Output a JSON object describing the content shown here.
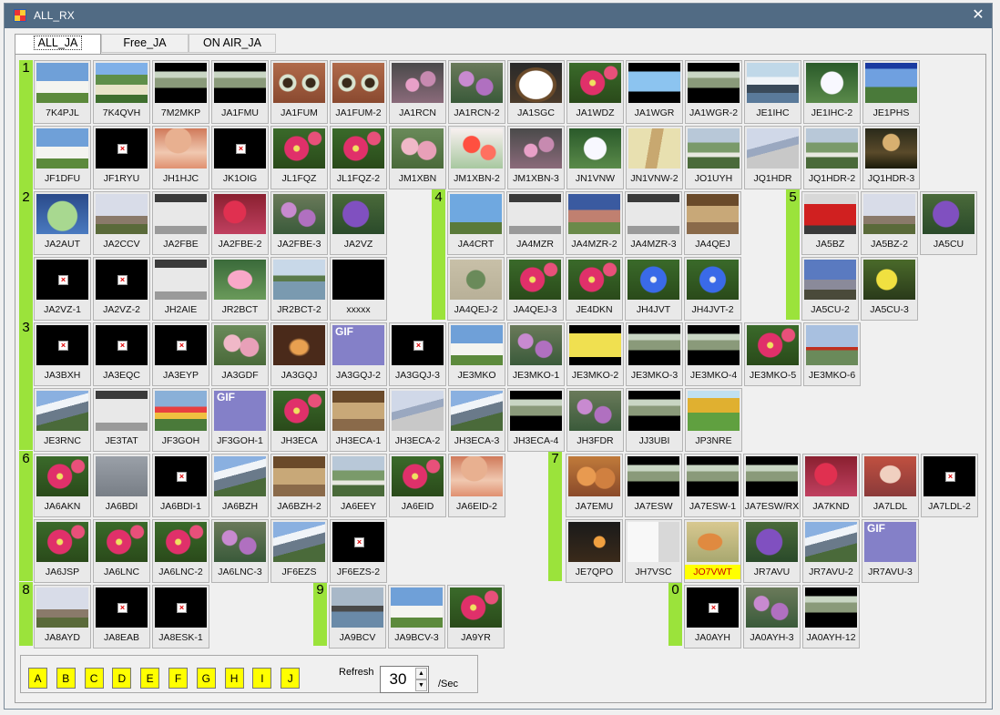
{
  "window": {
    "title": "ALL_RX",
    "close_glyph": "✕"
  },
  "tabs": [
    {
      "label": "ALL_JA",
      "active": true
    },
    {
      "label": "Free_JA",
      "active": false
    },
    {
      "label": "ON AIR_JA",
      "active": false
    }
  ],
  "area_markers": [
    "1",
    "2",
    "3",
    "4",
    "5",
    "6",
    "7",
    "8",
    "9",
    "0"
  ],
  "tiles": [
    {
      "c": "7K4PJL",
      "t": "bldg"
    },
    {
      "c": "7K4QVH",
      "t": "sign"
    },
    {
      "c": "7M2MKP",
      "t": "vid"
    },
    {
      "c": "JA1FMU",
      "t": "vid"
    },
    {
      "c": "JA1FUM",
      "t": "eyes"
    },
    {
      "c": "JA1FUM-2",
      "t": "eyes"
    },
    {
      "c": "JA1RCN",
      "t": "flw"
    },
    {
      "c": "JA1RCN-2",
      "t": "pflw"
    },
    {
      "c": "JA1SGC",
      "t": "bowl"
    },
    {
      "c": "JA1WDZ",
      "t": "pink"
    },
    {
      "c": "JA1WGR",
      "t": "sky"
    },
    {
      "c": "JA1WGR-2",
      "t": "vid"
    },
    {
      "c": "JE1IHC",
      "t": "wave"
    },
    {
      "c": "JE1IHC-2",
      "t": "lily"
    },
    {
      "c": "JE1PHS",
      "t": "blue"
    },
    {
      "c": "JF1DFU",
      "t": "bldg"
    },
    {
      "c": "JF1RYU",
      "t": "x"
    },
    {
      "c": "JH1HJC",
      "t": "hat"
    },
    {
      "c": "JK1OIG",
      "t": "x"
    },
    {
      "c": "JL1FQZ",
      "t": "pink"
    },
    {
      "c": "JL1FQZ-2",
      "t": "pink"
    },
    {
      "c": "JM1XBN",
      "t": "rose"
    },
    {
      "c": "JM1XBN-2",
      "t": "poppy"
    },
    {
      "c": "JM1XBN-3",
      "t": "flw"
    },
    {
      "c": "JN1VNW",
      "t": "lily"
    },
    {
      "c": "JN1VNW-2",
      "t": "hand"
    },
    {
      "c": "JO1UYH",
      "t": "garden"
    },
    {
      "c": "JQ1HDR",
      "t": "mtn"
    },
    {
      "c": "JQ1HDR-2",
      "t": "garden"
    },
    {
      "c": "JQ1HDR-3",
      "t": "lisa"
    },
    {
      "c": "JA2AUT",
      "t": "hydr"
    },
    {
      "c": "JA2CCV",
      "t": "tree"
    },
    {
      "c": "JA2FBE",
      "t": "scr"
    },
    {
      "c": "JA2FBE-2",
      "t": "red"
    },
    {
      "c": "JA2FBE-3",
      "t": "pflw"
    },
    {
      "c": "JA2VZ",
      "t": "purp"
    },
    {
      "c": "JA2VZ-1",
      "t": "x"
    },
    {
      "c": "JA2VZ-2",
      "t": "x"
    },
    {
      "c": "JH2AIE",
      "t": "scr"
    },
    {
      "c": "JR2BCT",
      "t": "lotus"
    },
    {
      "c": "JR2BCT-2",
      "t": "lake"
    },
    {
      "c": "xxxxx",
      "t": "black"
    },
    {
      "c": "JA4CRT",
      "t": "ant"
    },
    {
      "c": "JA4MZR",
      "t": "scr"
    },
    {
      "c": "JA4MZR-2",
      "t": "field"
    },
    {
      "c": "JA4MZR-3",
      "t": "scr"
    },
    {
      "c": "JA4QEJ",
      "t": "room"
    },
    {
      "c": "JA4QEJ-2",
      "t": "card"
    },
    {
      "c": "JA4QEJ-3",
      "t": "pink"
    },
    {
      "c": "JE4DKN",
      "t": "pink"
    },
    {
      "c": "JH4JVT",
      "t": "bflw"
    },
    {
      "c": "JH4JVT-2",
      "t": "bflw"
    },
    {
      "c": "JA5BZ",
      "t": "bus"
    },
    {
      "c": "JA5BZ-2",
      "t": "tree"
    },
    {
      "c": "JA5CU",
      "t": "purp"
    },
    {
      "c": "JA5CU-2",
      "t": "statue"
    },
    {
      "c": "JA5CU-3",
      "t": "yflw"
    },
    {
      "c": "JA3BXH",
      "t": "x"
    },
    {
      "c": "JA3EQC",
      "t": "x"
    },
    {
      "c": "JA3EYP",
      "t": "x"
    },
    {
      "c": "JA3GDF",
      "t": "rose"
    },
    {
      "c": "JA3GQJ",
      "t": "tunnel"
    },
    {
      "c": "JA3GQJ-2",
      "t": "gif"
    },
    {
      "c": "JA3GQJ-3",
      "t": "x"
    },
    {
      "c": "JE3MKO",
      "t": "bldg"
    },
    {
      "c": "JE3MKO-1",
      "t": "pflw"
    },
    {
      "c": "JE3MKO-2",
      "t": "yel"
    },
    {
      "c": "JE3MKO-3",
      "t": "vid"
    },
    {
      "c": "JE3MKO-4",
      "t": "vid"
    },
    {
      "c": "JE3MKO-5",
      "t": "pink"
    },
    {
      "c": "JE3MKO-6",
      "t": "torii"
    },
    {
      "c": "JE3RNC",
      "t": "fuji"
    },
    {
      "c": "JE3TAT",
      "t": "scr"
    },
    {
      "c": "JF3GOH",
      "t": "tulip"
    },
    {
      "c": "JF3GOH-1",
      "t": "gif"
    },
    {
      "c": "JH3ECA",
      "t": "pink"
    },
    {
      "c": "JH3ECA-1",
      "t": "room"
    },
    {
      "c": "JH3ECA-2",
      "t": "mtn"
    },
    {
      "c": "JH3ECA-3",
      "t": "fuji"
    },
    {
      "c": "JH3ECA-4",
      "t": "vid"
    },
    {
      "c": "JH3FDR",
      "t": "pflw"
    },
    {
      "c": "JJ3UBI",
      "t": "vid"
    },
    {
      "c": "JP3NRE",
      "t": "text"
    },
    {
      "c": "JA6AKN",
      "t": "pink"
    },
    {
      "c": "JA6BDI",
      "t": "grey"
    },
    {
      "c": "JA6BDI-1",
      "t": "x"
    },
    {
      "c": "JA6BZH",
      "t": "fuji"
    },
    {
      "c": "JA6BZH-2",
      "t": "room"
    },
    {
      "c": "JA6EEY",
      "t": "garden"
    },
    {
      "c": "JA6EID",
      "t": "pink"
    },
    {
      "c": "JA6EID-2",
      "t": "hat"
    },
    {
      "c": "JA6JSP",
      "t": "pink"
    },
    {
      "c": "JA6LNC",
      "t": "pink"
    },
    {
      "c": "JA6LNC-2",
      "t": "pink"
    },
    {
      "c": "JA6LNC-3",
      "t": "pflw"
    },
    {
      "c": "JF6EZS",
      "t": "fuji"
    },
    {
      "c": "JF6EZS-2",
      "t": "x"
    },
    {
      "c": "JA7EMU",
      "t": "cats"
    },
    {
      "c": "JA7ESW",
      "t": "vid"
    },
    {
      "c": "JA7ESW-1",
      "t": "vid"
    },
    {
      "c": "JA7ESW/RX",
      "t": "vid"
    },
    {
      "c": "JA7KND",
      "t": "red"
    },
    {
      "c": "JA7LDL",
      "t": "doll"
    },
    {
      "c": "JA7LDL-2",
      "t": "x"
    },
    {
      "c": "JE7QPO",
      "t": "fest"
    },
    {
      "c": "JH7VSC",
      "t": "doc"
    },
    {
      "c": "JO7VWT",
      "t": "squir",
      "hl": true
    },
    {
      "c": "JR7AVU",
      "t": "purp"
    },
    {
      "c": "JR7AVU-2",
      "t": "fuji"
    },
    {
      "c": "JR7AVU-3",
      "t": "gif"
    },
    {
      "c": "JA8AYD",
      "t": "tree"
    },
    {
      "c": "JA8EAB",
      "t": "x"
    },
    {
      "c": "JA8ESK-1",
      "t": "x"
    },
    {
      "c": "JA9BCV",
      "t": "bridge"
    },
    {
      "c": "JA9BCV-3",
      "t": "bldg"
    },
    {
      "c": "JA9YR",
      "t": "pink"
    },
    {
      "c": "JA0AYH",
      "t": "x"
    },
    {
      "c": "JA0AYH-3",
      "t": "pflw"
    },
    {
      "c": "JA0AYH-12",
      "t": "vid"
    }
  ],
  "gif_label": "GIF",
  "broken_glyph": "×",
  "letter_buttons": [
    "A",
    "B",
    "C",
    "D",
    "E",
    "F",
    "G",
    "H",
    "I",
    "J"
  ],
  "refresh": {
    "label": "Refresh",
    "value": "30",
    "unit": "/Sec",
    "up": "▲",
    "down": "▼"
  }
}
